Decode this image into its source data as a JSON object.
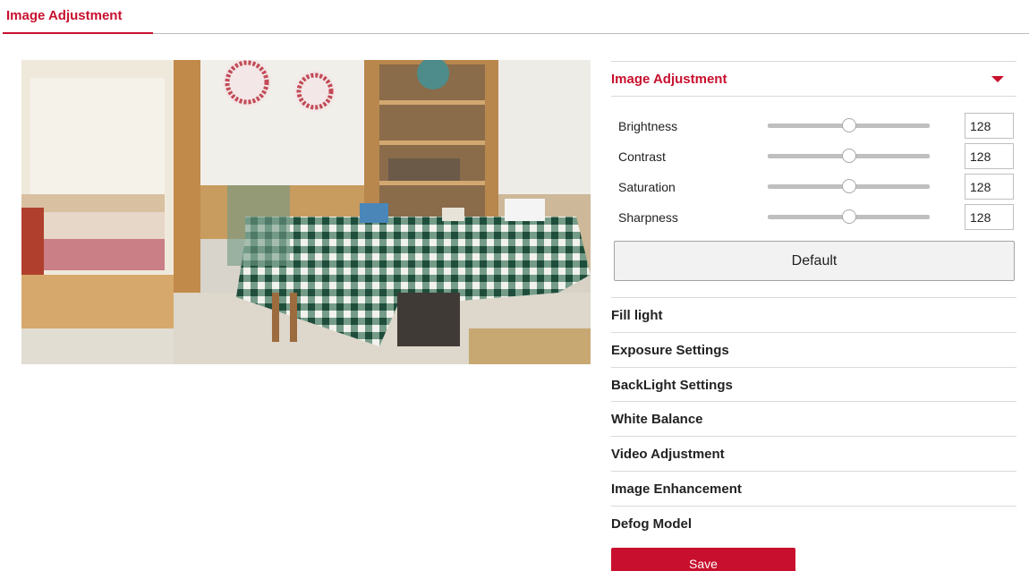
{
  "header": {
    "tab_label": "Image Adjustment"
  },
  "preview": {
    "kind": "camera-live-view"
  },
  "panel": {
    "active_section": {
      "title": "Image Adjustment",
      "expanded_icon": "caret-down-icon",
      "sliders": [
        {
          "label": "Brightness",
          "value": "128",
          "level": 0.5
        },
        {
          "label": "Contrast",
          "value": "128",
          "level": 0.5
        },
        {
          "label": "Saturation",
          "value": "128",
          "level": 0.5
        },
        {
          "label": "Sharpness",
          "value": "128",
          "level": 0.5
        }
      ],
      "default_label": "Default"
    },
    "collapsed_sections": [
      "Fill light",
      "Exposure Settings",
      "BackLight Settings",
      "White Balance",
      "Video Adjustment",
      "Image Enhancement",
      "Defog Model"
    ],
    "save_label": "Save"
  },
  "colors": {
    "accent": "#c8102e",
    "divider": "#d9d9d9",
    "track": "#bfbfbf"
  }
}
